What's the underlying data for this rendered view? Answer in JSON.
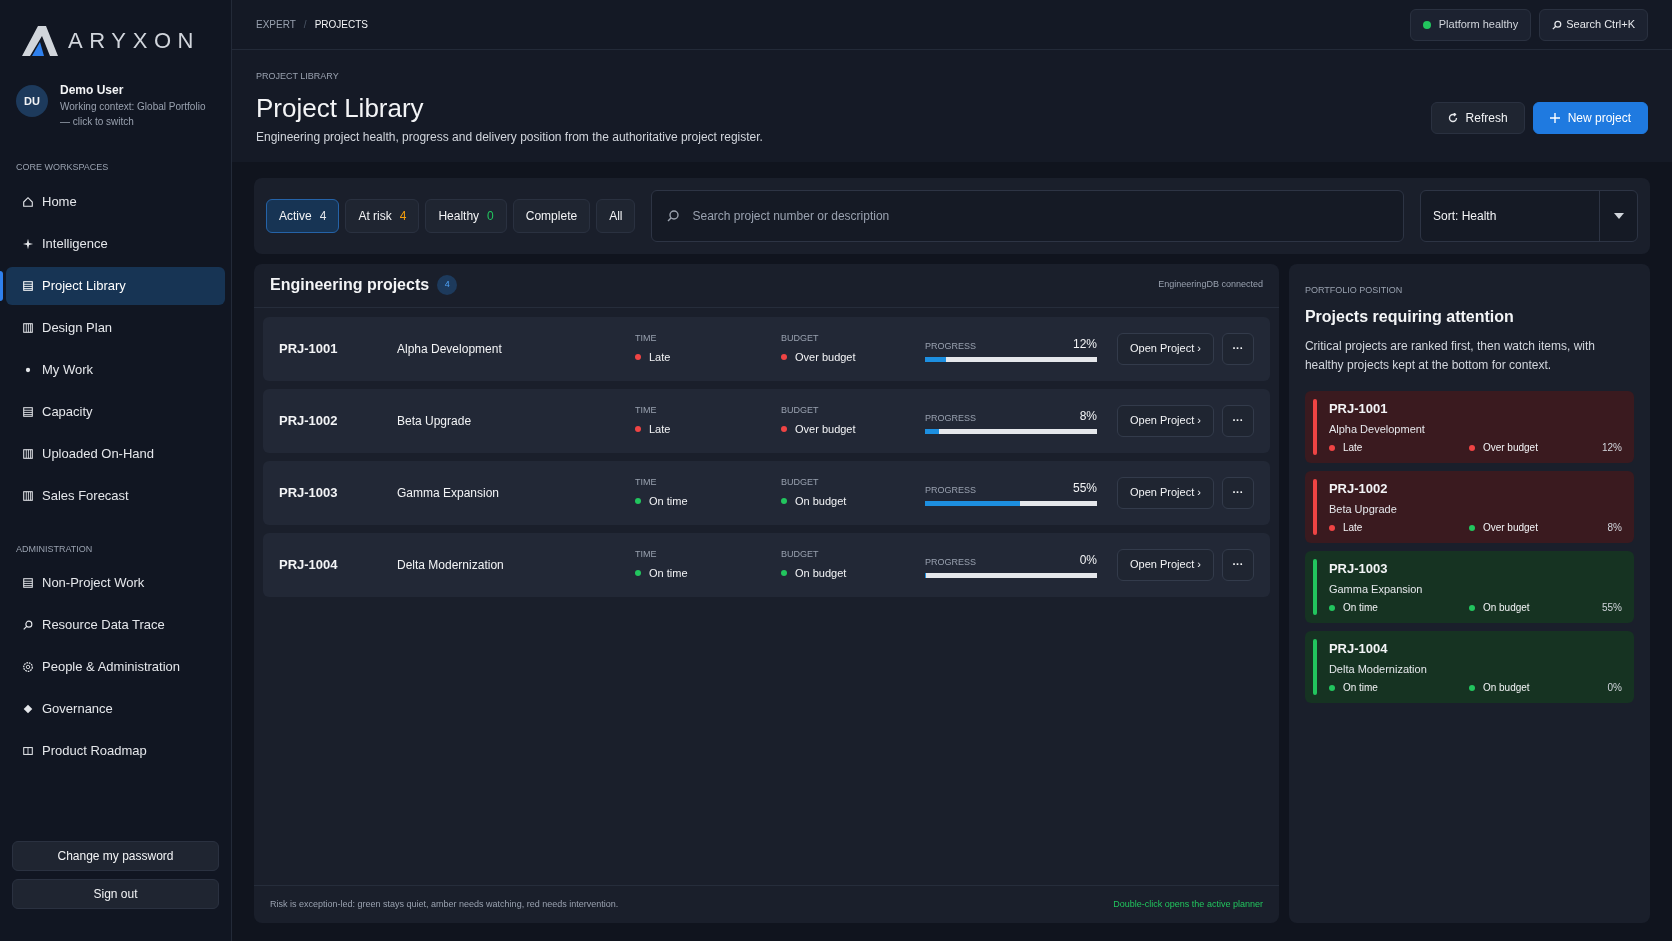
{
  "brand": {
    "name": "ARYXON"
  },
  "user": {
    "initials": "DU",
    "name": "Demo User",
    "context": "Working context: Global Portfolio — click to switch"
  },
  "sidebar": {
    "sections": [
      {
        "title": "CORE WORKSPACES",
        "items": [
          {
            "label": "Home",
            "selected": false
          },
          {
            "label": "Intelligence",
            "selected": false
          },
          {
            "label": "Project Library",
            "selected": true
          },
          {
            "label": "Design Plan",
            "selected": false
          },
          {
            "label": "My Work",
            "selected": false
          },
          {
            "label": "Capacity",
            "selected": false
          },
          {
            "label": "Uploaded On-Hand",
            "selected": false
          },
          {
            "label": "Sales Forecast",
            "selected": false
          }
        ]
      },
      {
        "title": "ADMINISTRATION",
        "items": [
          {
            "label": "Non-Project Work",
            "selected": false
          },
          {
            "label": "Resource Data Trace",
            "selected": false
          },
          {
            "label": "People & Administration",
            "selected": false
          },
          {
            "label": "Governance",
            "selected": false
          },
          {
            "label": "Product Roadmap",
            "selected": false
          }
        ]
      }
    ],
    "buttons": [
      "Change my password",
      "Sign out"
    ]
  },
  "breadcrumb": {
    "separator": "/",
    "items": [
      {
        "label": "EXPERT",
        "current": false
      },
      {
        "label": "PROJECTS",
        "current": true
      }
    ]
  },
  "topbar": {
    "status": {
      "label": "Platform healthy",
      "color": "#22c55e"
    },
    "search": "Search Ctrl+K"
  },
  "header": {
    "eyebrow": "PROJECT LIBRARY",
    "title": "Project Library",
    "subtitle": "Engineering project health, progress and delivery position from the authoritative project register.",
    "buttons": [
      {
        "label": "Refresh",
        "kind": "secondary"
      },
      {
        "label": "New project",
        "kind": "primary"
      }
    ]
  },
  "filters": [
    {
      "label": "Active",
      "count": "4",
      "color": "#e5e7eb",
      "selected": true
    },
    {
      "label": "At risk",
      "count": "4",
      "color": "#f59e0b",
      "selected": false
    },
    {
      "label": "Healthy",
      "count": "0",
      "color": "#22c55e",
      "selected": false
    },
    {
      "label": "Complete",
      "selected": false
    },
    {
      "label": "All",
      "selected": false
    }
  ],
  "search": {
    "placeholder": "Search project number or description"
  },
  "sort": {
    "value": "Sort: Health"
  },
  "projects_panel": {
    "title": "Engineering projects",
    "count": "4",
    "source": "EngineeringDB connected",
    "rows": [
      {
        "id": "PRJ-1001",
        "name": "Alpha Development",
        "time_label": "TIME",
        "time": {
          "label": "Late",
          "color": "#ef4444"
        },
        "budget_label": "BUDGET",
        "budget": {
          "label": "Over budget",
          "color": "#ef4444"
        },
        "progress_label": "PROGRESS",
        "progress": "12%",
        "level": 0.12,
        "action": "Open Project ›",
        "more": "···"
      },
      {
        "id": "PRJ-1002",
        "name": "Beta Upgrade",
        "time_label": "TIME",
        "time": {
          "label": "Late",
          "color": "#ef4444"
        },
        "budget_label": "BUDGET",
        "budget": {
          "label": "Over budget",
          "color": "#ef4444"
        },
        "progress_label": "PROGRESS",
        "progress": "8%",
        "level": 0.08,
        "action": "Open Project ›",
        "more": "···"
      },
      {
        "id": "PRJ-1003",
        "name": "Gamma Expansion",
        "time_label": "TIME",
        "time": {
          "label": "On time",
          "color": "#22c55e"
        },
        "budget_label": "BUDGET",
        "budget": {
          "label": "On budget",
          "color": "#22c55e"
        },
        "progress_label": "PROGRESS",
        "progress": "55%",
        "level": 0.55,
        "action": "Open Project ›",
        "more": "···"
      },
      {
        "id": "PRJ-1004",
        "name": "Delta Modernization",
        "time_label": "TIME",
        "time": {
          "label": "On time",
          "color": "#22c55e"
        },
        "budget_label": "BUDGET",
        "budget": {
          "label": "On budget",
          "color": "#22c55e"
        },
        "progress_label": "PROGRESS",
        "progress": "0%",
        "level": 0,
        "action": "Open Project ›",
        "more": "···"
      }
    ],
    "footer_note": "Risk is exception-led: green stays quiet, amber needs watching, red needs intervention.",
    "footer_hint": "Double-click opens the active planner"
  },
  "attention_panel": {
    "eyebrow": "PORTFOLIO POSITION",
    "title": "Projects requiring attention",
    "description": "Critical projects are ranked first, then watch items, with healthy projects kept at the bottom for context.",
    "cards": [
      {
        "kind": "critical",
        "id": "PRJ-1001",
        "name": "Alpha Development",
        "time": {
          "label": "Late",
          "color": "#ef4444"
        },
        "budget": {
          "label": "Over budget",
          "color": "#ef4444"
        },
        "progress": "12%"
      },
      {
        "kind": "critical",
        "id": "PRJ-1002",
        "name": "Beta Upgrade",
        "time": {
          "label": "Late",
          "color": "#ef4444"
        },
        "budget": {
          "label": "Over budget",
          "color": "#22c55e"
        },
        "progress": "8%"
      },
      {
        "kind": "healthy",
        "id": "PRJ-1003",
        "name": "Gamma Expansion",
        "time": {
          "label": "On time",
          "color": "#22c55e"
        },
        "budget": {
          "label": "On budget",
          "color": "#22c55e"
        },
        "progress": "55%"
      },
      {
        "kind": "healthy",
        "id": "PRJ-1004",
        "name": "Delta Modernization",
        "time": {
          "label": "On time",
          "color": "#22c55e"
        },
        "budget": {
          "label": "On budget",
          "color": "#22c55e"
        },
        "progress": "0%"
      }
    ]
  }
}
